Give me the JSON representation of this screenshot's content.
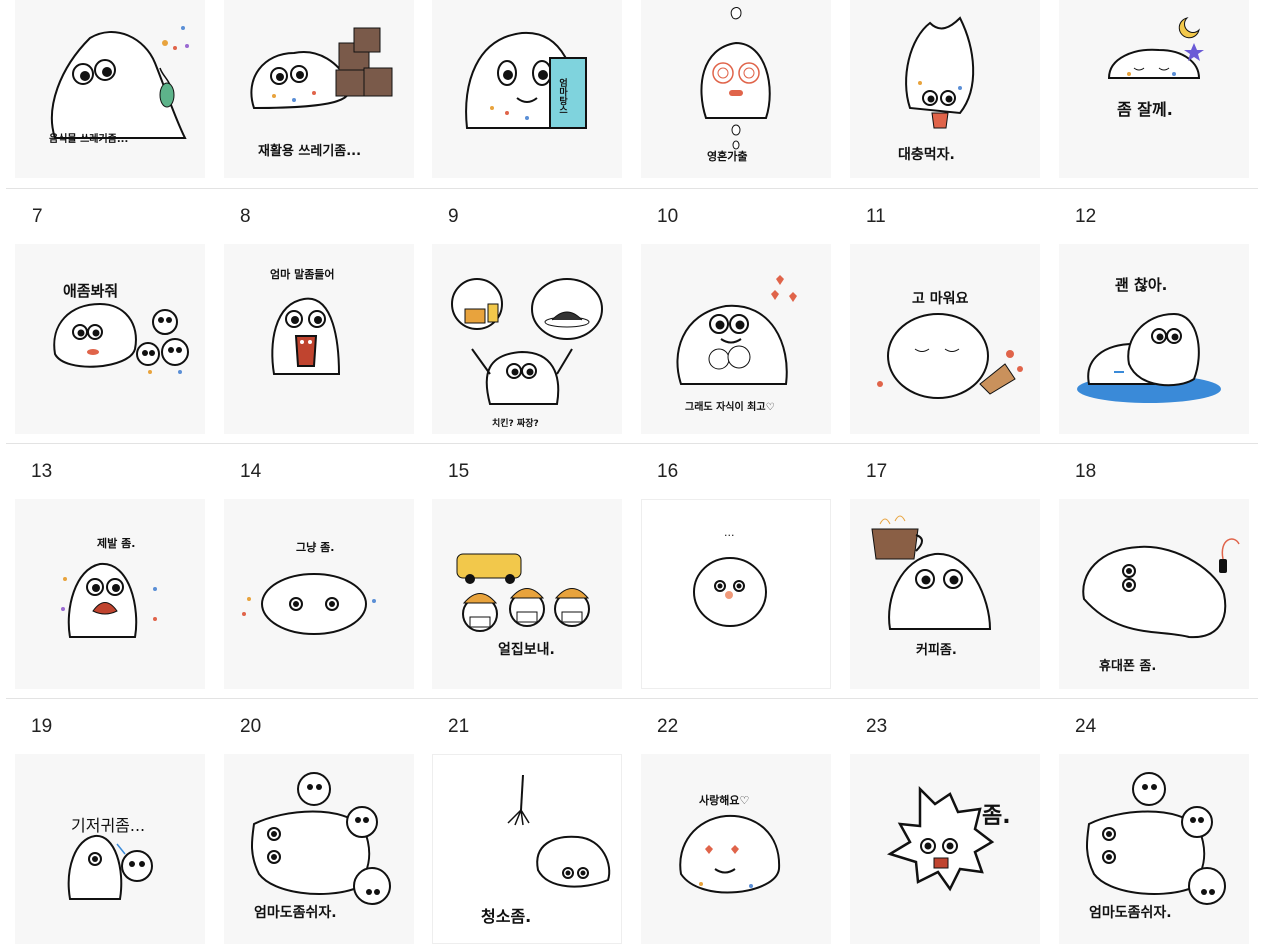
{
  "stickers": [
    {
      "number": "",
      "caption": "음식물 쓰레기좀..."
    },
    {
      "number": "",
      "caption": "재활용 쓰레기좀..."
    },
    {
      "number": "",
      "caption": "엄마탕스"
    },
    {
      "number": "",
      "caption": "영혼가출"
    },
    {
      "number": "",
      "caption": "대충먹자."
    },
    {
      "number": "",
      "caption": "좀 잘께."
    },
    {
      "number": "7",
      "caption": "애좀봐줘"
    },
    {
      "number": "8",
      "caption": "엄마 말좀들어"
    },
    {
      "number": "9",
      "caption": "치킨? 짜장?"
    },
    {
      "number": "10",
      "caption": "그래도 자식이 최고♡"
    },
    {
      "number": "11",
      "caption": "고 마워요"
    },
    {
      "number": "12",
      "caption": "괜 찮아."
    },
    {
      "number": "13",
      "caption": "제발 좀."
    },
    {
      "number": "14",
      "caption": "그냥 좀."
    },
    {
      "number": "15",
      "caption": "얼집보내."
    },
    {
      "number": "16",
      "caption": "..."
    },
    {
      "number": "17",
      "caption": "커피좀."
    },
    {
      "number": "18",
      "caption": "휴대폰 좀."
    },
    {
      "number": "19",
      "caption": "기저귀좀..."
    },
    {
      "number": "20",
      "caption": "엄마도좀쉬자."
    },
    {
      "number": "21",
      "caption": "청소좀."
    },
    {
      "number": "22",
      "caption": "사랑해요♡"
    },
    {
      "number": "23",
      "caption": "좀."
    },
    {
      "number": "24",
      "caption": "엄마도좀쉬자."
    }
  ],
  "colors": {
    "tile_bg": "#f7f7f7",
    "outline": "#111111",
    "confetti": [
      "#e8a33d",
      "#5b8fd6",
      "#e0644a",
      "#9a6ad1",
      "#f2c84b",
      "#63b36e"
    ]
  }
}
